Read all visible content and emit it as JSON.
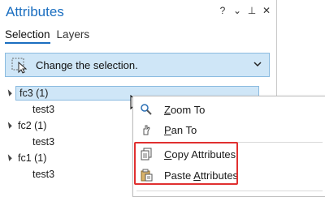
{
  "pane": {
    "title": "Attributes",
    "tools": {
      "help": "?",
      "menu": "⌄",
      "pin": "⊥",
      "close": "✕"
    }
  },
  "tabs": [
    {
      "label": "Selection",
      "active": true
    },
    {
      "label": "Layers",
      "active": false
    }
  ],
  "selection_dropdown": {
    "label": "Change the selection.",
    "icon": "select-arrow-icon"
  },
  "tree": [
    {
      "label": "fc3 (1)",
      "selected": true,
      "children": [
        "test3"
      ]
    },
    {
      "label": "fc2 (1)",
      "selected": false,
      "children": [
        "test3"
      ]
    },
    {
      "label": "fc1 (1)",
      "selected": false,
      "children": [
        "test3"
      ]
    }
  ],
  "context_menu": {
    "items": [
      {
        "pre": "",
        "u": "Z",
        "post": "oom To",
        "icon": "zoom-to-icon"
      },
      {
        "pre": "",
        "u": "P",
        "post": "an To",
        "icon": "pan-to-icon"
      },
      {
        "pre": "",
        "u": "C",
        "post": "opy Attributes",
        "icon": "copy-attributes-icon"
      },
      {
        "pre": "Paste ",
        "u": "A",
        "post": "ttributes",
        "icon": "paste-attributes-icon"
      }
    ]
  },
  "colors": {
    "accent": "#1a6ec0",
    "selection_bg": "#cfe6f7",
    "highlight": "#e03030"
  }
}
